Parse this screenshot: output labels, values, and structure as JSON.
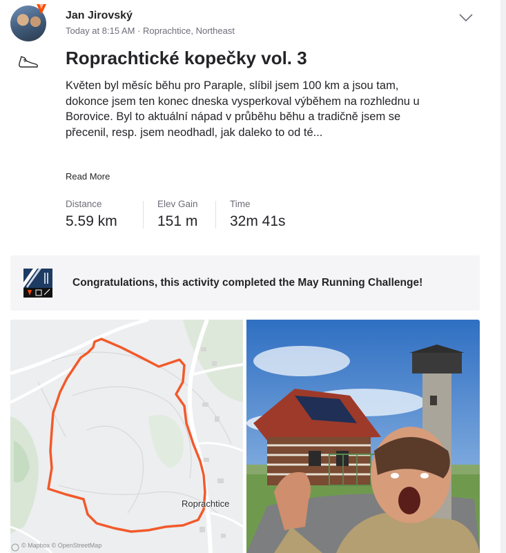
{
  "athlete": {
    "name": "Jan Jirovský",
    "meta": "Today at 8:15 AM · Roprachtice, Northeast"
  },
  "activity": {
    "type_icon": "running-shoe-icon",
    "title": "Roprachtické kopečky vol. 3",
    "description": "Květen byl měsíc běhu pro Paraple, slíbil jsem 100 km a jsou tam, dokonce jsem ten konec dneska vysperkoval výběhem na rozhlednu u Borovice. Byl to aktuální nápad v průběhu běhu a tradičně jsem se přecenil, resp. jsem neodhadl, jak daleko to od té...",
    "read_more": "Read More"
  },
  "stats": [
    {
      "label": "Distance",
      "value": "5.59 km"
    },
    {
      "label": "Elev Gain",
      "value": "151 m"
    },
    {
      "label": "Time",
      "value": "32m 41s"
    }
  ],
  "challenge": {
    "text": "Congratulations, this activity completed the May Running Challenge!"
  },
  "map": {
    "place": "Roprachtice",
    "attribution": "© Mapbox © OpenStreetMap"
  },
  "colors": {
    "brand": "#fc4c02",
    "route": "#f2592a",
    "text": "#242428",
    "muted": "#6d6d78"
  }
}
